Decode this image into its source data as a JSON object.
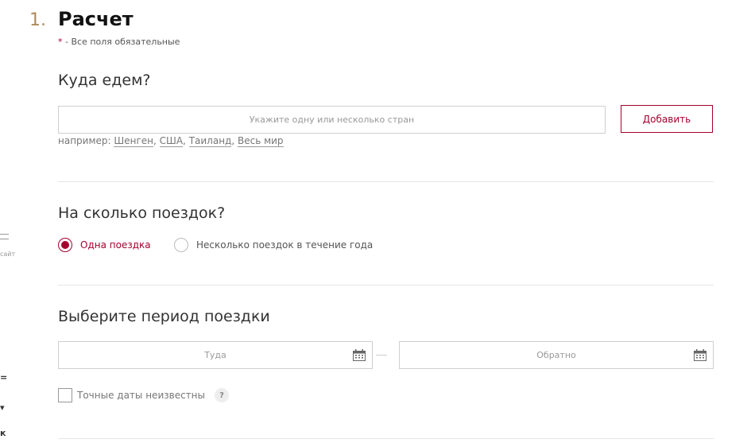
{
  "left_edge": {
    "site_label": "сайт"
  },
  "step": {
    "number": "1.",
    "title": "Расчет"
  },
  "required_note": {
    "star": "*",
    "text": " - Все поля обязательные"
  },
  "destination": {
    "title": "Куда едем?",
    "placeholder": "Укажите одну или несколько стран",
    "add_button": "Добавить",
    "examples_prefix": "например:",
    "examples": [
      "Шенген",
      "США",
      "Таиланд",
      "Весь мир"
    ]
  },
  "trips": {
    "title": "На сколько поездок?",
    "options": [
      {
        "label": "Одна поездка",
        "checked": true
      },
      {
        "label": "Несколько поездок в течение года",
        "checked": false
      }
    ]
  },
  "period": {
    "title": "Выберите период поездки",
    "from_placeholder": "Туда",
    "to_placeholder": "Обратно",
    "unknown_dates_label": "Точные даты неизвестны",
    "help": "?"
  }
}
